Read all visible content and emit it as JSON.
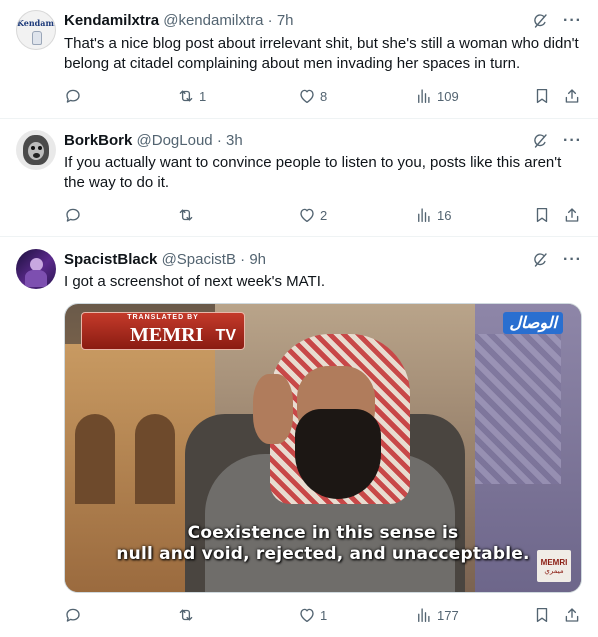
{
  "tweets": [
    {
      "name": "Kendamilxtra",
      "handle": "@kendamilxtra",
      "time": "7h",
      "text": "That's a nice blog post about irrelevant shit, but she's still a woman who didn't belong at citadel complaining about men invading her spaces in turn.",
      "avatar_text": "Kendamil",
      "reply_count": "",
      "retweet_count": "1",
      "like_count": "8",
      "view_count": "109"
    },
    {
      "name": "BorkBork",
      "handle": "@DogLoud",
      "time": "3h",
      "text": "If you actually want to convince people to listen to you, posts like this aren't the way to do it.",
      "reply_count": "",
      "retweet_count": "",
      "like_count": "2",
      "view_count": "16"
    },
    {
      "name": "SpacistBlack",
      "handle": "@SpacistB",
      "time": "9h",
      "text": "I got a screenshot of next week's MATI.",
      "reply_count": "",
      "retweet_count": "",
      "like_count": "1",
      "view_count": "177",
      "media": {
        "logo_top": "TRANSLATED BY",
        "logo_main": "MEMRI",
        "logo_tv": "TV",
        "channel_logo": "الوصال",
        "caption_line1": "Coexistence in this sense is",
        "caption_line2": "null and void, rejected, and unacceptable.",
        "corner_logo": "MEMRI",
        "corner_logo_sub": "ميمري"
      }
    }
  ],
  "separator": "·",
  "icons": [
    "grok-icon",
    "more-icon",
    "reply-icon",
    "retweet-icon",
    "like-icon",
    "views-icon",
    "bookmark-icon",
    "share-icon"
  ]
}
